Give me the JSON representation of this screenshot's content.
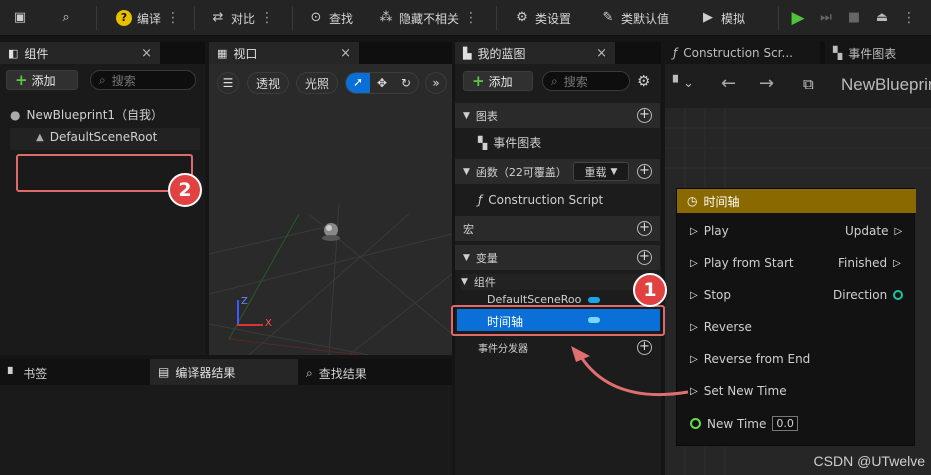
{
  "toolbar": {
    "compile_label": "编译",
    "diff_label": "对比",
    "find_label": "查找",
    "hide_unrelated_label": "隐藏不相关",
    "class_settings_label": "类设置",
    "class_defaults_label": "类默认值",
    "simulate_label": "模拟"
  },
  "components_panel": {
    "tab_label": "组件",
    "add_label": "添加",
    "search_placeholder": "搜索",
    "root_label": "NewBlueprint1（自我）",
    "child_label": "DefaultSceneRoot"
  },
  "viewport_panel": {
    "tab_label": "视口",
    "lit_mode_label": "透视",
    "lighting_label": "光照",
    "axis_z": "Z",
    "axis_x": "X"
  },
  "bottom_panel": {
    "bookmarks_label": "书签",
    "compiler_results_label": "编译器结果",
    "find_results_label": "查找结果"
  },
  "my_blueprint": {
    "tab_label": "我的蓝图",
    "add_label": "添加",
    "search_placeholder": "搜索",
    "graphs_label": "图表",
    "event_graph_label": "事件图表",
    "functions_label": "函数（22可覆盖）",
    "override_label": "重载",
    "construction_script_label": "Construction Script",
    "macros_label": "宏",
    "variables_label": "变量",
    "components_label": "组件",
    "default_scene_root_var": "DefaultSceneRoo",
    "timeline_var": "时间轴",
    "event_dispatchers_label": "事件分发器"
  },
  "graph_tabs": {
    "construction_tab": "Construction Scr...",
    "event_graph_tab": "事件图表",
    "breadcrumb": "NewBlueprint"
  },
  "timeline_node": {
    "title": "时间轴",
    "inputs": [
      "Play",
      "Play from Start",
      "Stop",
      "Reverse",
      "Reverse from End",
      "Set New Time"
    ],
    "outputs": [
      "Update",
      "Finished",
      "Direction"
    ],
    "new_time_label": "New Time",
    "new_time_value": "0.0"
  },
  "annotations": {
    "badge_1": "1",
    "badge_2": "2"
  },
  "watermark": "CSDN @UTwelve",
  "colors": {
    "accent_blue": "#0070e0",
    "node_header": "#8a6a00",
    "add_plus": "#5ec44a",
    "annotation_red": "#e14141",
    "direction_pin": "#17c4a0"
  }
}
